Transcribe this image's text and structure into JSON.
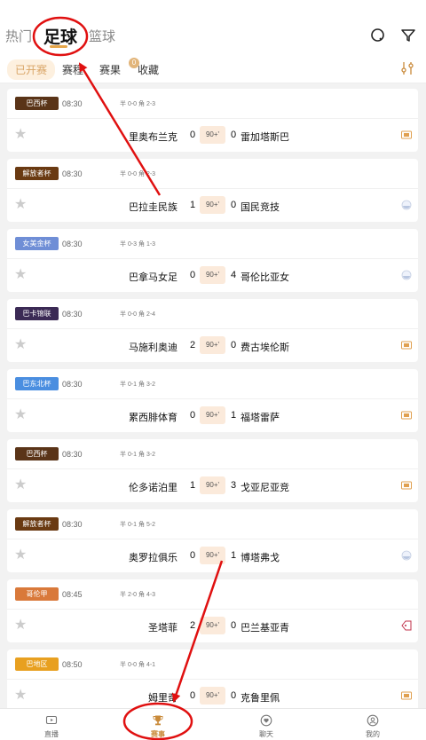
{
  "header": {
    "tabs": [
      {
        "label": "热门"
      },
      {
        "label": "足球"
      },
      {
        "label": "篮球"
      }
    ]
  },
  "subtabs": [
    {
      "label": "已开赛"
    },
    {
      "label": "赛程"
    },
    {
      "label": "赛果"
    },
    {
      "label": "收藏"
    }
  ],
  "favorites_count": "0",
  "matches": [
    {
      "league": "巴西杯",
      "league_color": "#5a3418",
      "time": "08:30",
      "half": "半 0-0 角 2-3",
      "home": "里奥布兰克",
      "home_score": "0",
      "status": "90+'",
      "away_score": "0",
      "away": "雷加塔斯巴",
      "media": "video"
    },
    {
      "league": "解放者杯",
      "league_color": "#6a3a12",
      "time": "08:30",
      "half": "半 0-0 角 2-3",
      "home": "巴拉圭民族",
      "home_score": "1",
      "status": "90+'",
      "away_score": "0",
      "away": "国民竞技",
      "media": "animation"
    },
    {
      "league": "女美金杯",
      "league_color": "#6f8ed6",
      "time": "08:30",
      "half": "半 0-3 角 1-3",
      "home": "巴拿马女足",
      "home_score": "0",
      "status": "90+'",
      "away_score": "4",
      "away": "哥伦比亚女",
      "media": "animation"
    },
    {
      "league": "巴卡锦联",
      "league_color": "#3b2a55",
      "time": "08:30",
      "half": "半 0-0 角 2-4",
      "home": "马施利奥迪",
      "home_score": "2",
      "status": "90+'",
      "away_score": "0",
      "away": "费古埃伦斯",
      "media": "video"
    },
    {
      "league": "巴东北杯",
      "league_color": "#4a8ee0",
      "time": "08:30",
      "half": "半 0-1 角 3-2",
      "home": "累西腓体育",
      "home_score": "0",
      "status": "90+'",
      "away_score": "1",
      "away": "福塔雷萨",
      "media": "video"
    },
    {
      "league": "巴西杯",
      "league_color": "#5a3418",
      "time": "08:30",
      "half": "半 0-1 角 3-2",
      "home": "伦多诺泊里",
      "home_score": "1",
      "status": "90+'",
      "away_score": "3",
      "away": "戈亚尼亚竞",
      "media": "video"
    },
    {
      "league": "解放者杯",
      "league_color": "#6a3a12",
      "time": "08:30",
      "half": "半 0-1 角 5-2",
      "home": "奥罗拉俱乐",
      "home_score": "0",
      "status": "90+'",
      "away_score": "1",
      "away": "博塔弗戈",
      "media": "animation"
    },
    {
      "league": "哥伦甲",
      "league_color": "#d9793a",
      "time": "08:45",
      "half": "半 2-0 角 4-3",
      "home": "圣塔菲",
      "home_score": "2",
      "status": "90+'",
      "away_score": "0",
      "away": "巴兰基亚青",
      "media": "tag"
    },
    {
      "league": "巴地区",
      "league_color": "#e8a020",
      "time": "08:50",
      "half": "半 0-0 角 4-1",
      "home": "姆里奇",
      "home_score": "0",
      "status": "90+'",
      "away_score": "0",
      "away": "克鲁里佩",
      "media": "video"
    }
  ],
  "bottom_nav": [
    {
      "label": "直播",
      "icon": "tv-icon"
    },
    {
      "label": "赛事",
      "icon": "trophy-icon"
    },
    {
      "label": "聊天",
      "icon": "heart-chat-icon"
    },
    {
      "label": "我的",
      "icon": "user-icon"
    }
  ],
  "colors": {
    "accent": "#e6a64a",
    "annotation": "#e01010"
  }
}
